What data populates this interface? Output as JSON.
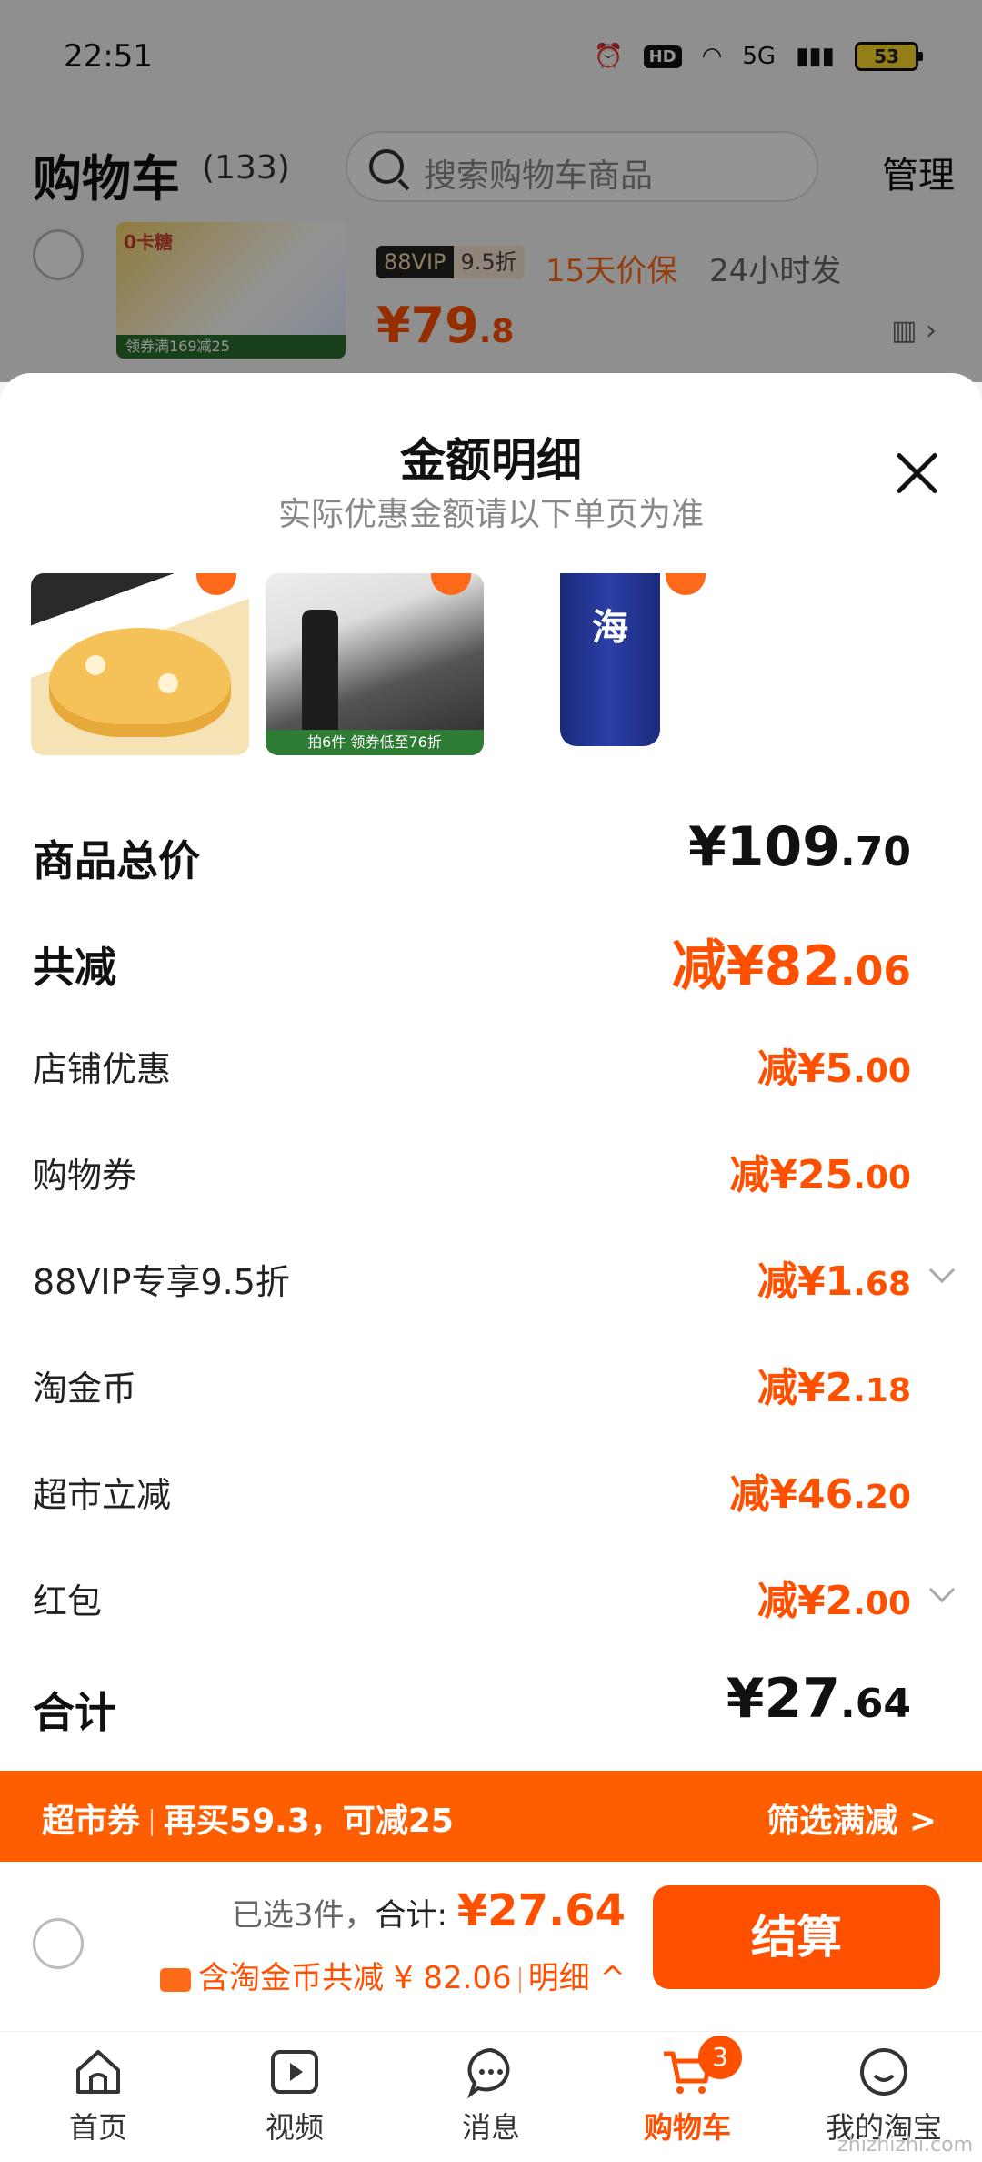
{
  "status_bar": {
    "time": "22:51",
    "hd": "HD",
    "network": "5G",
    "battery": "53"
  },
  "cart_header": {
    "title": "购物车",
    "count": "(133)",
    "search_placeholder": "搜索购物车商品",
    "manage": "管理"
  },
  "bg_item": {
    "img_tag": "领券满169减25",
    "img_tag2": "0卡糖",
    "vip_label": "88VIP",
    "vip_discount": "9.5折",
    "price_protect": "15天价保",
    "ship": "24小时发",
    "price_main": "¥79",
    "price_decimal": ".8"
  },
  "sheet": {
    "title": "金额明细",
    "subtitle": "实际优惠金额请以下单页为准",
    "thumbs": [
      {
        "tag": ""
      },
      {
        "tag": "拍6件 领券低至76折"
      },
      {
        "text": "海"
      }
    ],
    "rows": [
      {
        "label": "商品总价",
        "value_main": "¥109",
        "value_decimal": ".70"
      },
      {
        "label": "共减",
        "value_main": "减¥82",
        "value_decimal": ".06"
      },
      {
        "label": "店铺优惠",
        "value_main": "减¥5",
        "value_decimal": ".00"
      },
      {
        "label": "购物券",
        "value_main": "减¥25",
        "value_decimal": ".00"
      },
      {
        "label": "88VIP专享9.5折",
        "value_main": "减¥1",
        "value_decimal": ".68"
      },
      {
        "label": "淘金币",
        "value_main": "减¥2",
        "value_decimal": ".18"
      },
      {
        "label": "超市立减",
        "value_main": "减¥46",
        "value_decimal": ".20"
      },
      {
        "label": "红包",
        "value_main": "减¥2",
        "value_decimal": ".00"
      },
      {
        "label": "合计",
        "value_main": "¥27",
        "value_decimal": ".64"
      }
    ]
  },
  "promo_bar": {
    "label": "超市券",
    "text": "再买59.3，可减25",
    "action": "筛选满减 >"
  },
  "checkout": {
    "selected": "已选3件，",
    "total_label": "合计: ",
    "total_value": "¥27.64",
    "coin_text": "含淘金币共减 ¥ 82.06",
    "detail": "明细 ^",
    "button": "结算"
  },
  "tabs": [
    {
      "label": "首页"
    },
    {
      "label": "视频"
    },
    {
      "label": "消息"
    },
    {
      "label": "购物车",
      "badge": "3"
    },
    {
      "label": "我的淘宝"
    }
  ],
  "watermark": "zhizhizhi.com",
  "colors": {
    "accent": "#ff5000",
    "promo_bg": "#ff5e00"
  }
}
